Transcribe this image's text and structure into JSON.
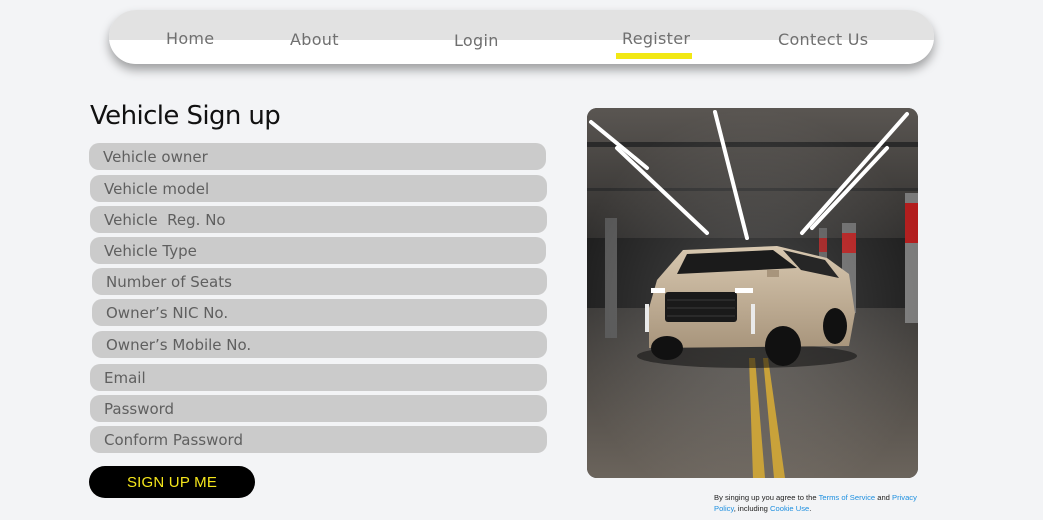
{
  "nav": {
    "items": [
      {
        "label": "Home"
      },
      {
        "label": "About"
      },
      {
        "label": "Login"
      },
      {
        "label": "Register"
      },
      {
        "label": "Contect Us"
      }
    ],
    "active_index": 3,
    "active_color": "#f2e814"
  },
  "form": {
    "title": "Vehicle Sign up",
    "fields": [
      {
        "placeholder": "Vehicle owner"
      },
      {
        "placeholder": "Vehicle model"
      },
      {
        "placeholder": "Vehicle  Reg. No"
      },
      {
        "placeholder": "Vehicle Type"
      },
      {
        "placeholder": "Number of Seats"
      },
      {
        "placeholder": "Owner’s NIC No."
      },
      {
        "placeholder": "Owner’s Mobile No."
      },
      {
        "placeholder": "Email"
      },
      {
        "placeholder": "Password"
      },
      {
        "placeholder": "Conform Password"
      }
    ],
    "submit_label": "SIGN UP ME"
  },
  "terms": {
    "prefix": "By singing up you agree to the ",
    "terms_link": "Terms of Service",
    "and": " and ",
    "privacy_link": "Privacy Policy",
    "including": ", including ",
    "cookie_link": "Cookie Use",
    "suffix": "."
  },
  "colors": {
    "page_bg": "#f3f4f6",
    "field_bg": "#cbcbcb",
    "button_bg": "#000000",
    "button_text": "#f5e61b",
    "link": "#1d8fe0"
  }
}
